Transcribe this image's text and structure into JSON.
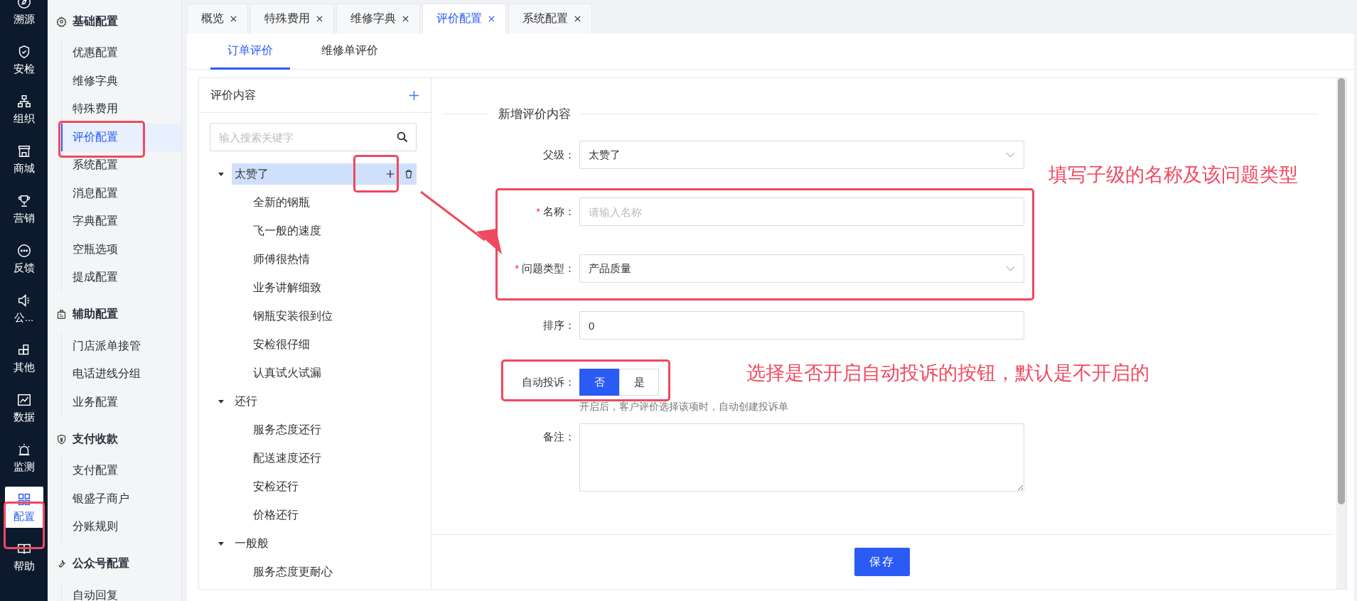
{
  "rail": [
    {
      "label": "溯源",
      "kind": "compass",
      "selected": false
    },
    {
      "label": "安检",
      "kind": "shield",
      "selected": false
    },
    {
      "label": "组织",
      "kind": "org",
      "selected": false
    },
    {
      "label": "商城",
      "kind": "store",
      "selected": false
    },
    {
      "label": "营销",
      "kind": "trophy",
      "selected": false
    },
    {
      "label": "反馈",
      "kind": "chat",
      "selected": false
    },
    {
      "label": "公...",
      "kind": "speaker",
      "selected": false
    },
    {
      "label": "其他",
      "kind": "blocks",
      "selected": false
    },
    {
      "label": "数据",
      "kind": "chart",
      "selected": false
    },
    {
      "label": "监测",
      "kind": "alarm",
      "selected": false
    },
    {
      "label": "配置",
      "kind": "grid",
      "selected": true
    },
    {
      "label": "帮助",
      "kind": "book",
      "selected": false
    }
  ],
  "menu": [
    {
      "title": "基础配置",
      "kind": "gear",
      "items": [
        {
          "label": "优惠配置",
          "selected": false
        },
        {
          "label": "维修字典",
          "selected": false
        },
        {
          "label": "特殊费用",
          "selected": false
        },
        {
          "label": "评价配置",
          "selected": true
        },
        {
          "label": "系统配置",
          "selected": false
        },
        {
          "label": "消息配置",
          "selected": false
        },
        {
          "label": "字典配置",
          "selected": false
        },
        {
          "label": "空瓶选项",
          "selected": false
        },
        {
          "label": "提成配置",
          "selected": false
        }
      ]
    },
    {
      "title": "辅助配置",
      "kind": "badge",
      "items": [
        {
          "label": "门店派单接管",
          "selected": false
        },
        {
          "label": "电话进线分组",
          "selected": false
        },
        {
          "label": "业务配置",
          "selected": false
        }
      ]
    },
    {
      "title": "支付收款",
      "kind": "yen",
      "items": [
        {
          "label": "支付配置",
          "selected": false
        },
        {
          "label": "银盛子商户",
          "selected": false
        },
        {
          "label": "分账规则",
          "selected": false
        }
      ]
    },
    {
      "title": "公众号配置",
      "kind": "wrench",
      "items": [
        {
          "label": "自动回复",
          "selected": false
        }
      ]
    }
  ],
  "tabs": [
    {
      "label": "概览",
      "selected": false
    },
    {
      "label": "特殊费用",
      "selected": false
    },
    {
      "label": "维修字典",
      "selected": false
    },
    {
      "label": "评价配置",
      "selected": true
    },
    {
      "label": "系统配置",
      "selected": false
    }
  ],
  "subtabs": [
    {
      "label": "订单评价",
      "selected": true
    },
    {
      "label": "维修单评价",
      "selected": false
    }
  ],
  "tree_panel": {
    "title": "评价内容",
    "search": {
      "placeholder": "输入搜索关键字"
    },
    "nodes": [
      {
        "label": "太赞了",
        "expanded": true,
        "selected": true,
        "children": [
          {
            "label": "全新的钢瓶",
            "selected": false
          },
          {
            "label": "飞一般的速度",
            "selected": false
          },
          {
            "label": "师傅很热情",
            "selected": false
          },
          {
            "label": "业务讲解细致",
            "selected": false
          },
          {
            "label": "钢瓶安装很到位",
            "selected": false
          },
          {
            "label": "安检很仔细",
            "selected": false
          },
          {
            "label": "认真试火试漏",
            "selected": false
          }
        ]
      },
      {
        "label": "还行",
        "expanded": true,
        "selected": false,
        "children": [
          {
            "label": "服务态度还行",
            "selected": false
          },
          {
            "label": "配送速度还行",
            "selected": false
          },
          {
            "label": "安检还行",
            "selected": false
          },
          {
            "label": "价格还行",
            "selected": false
          }
        ]
      },
      {
        "label": "一般般",
        "expanded": true,
        "selected": false,
        "children": [
          {
            "label": "服务态度更耐心",
            "selected": false
          }
        ]
      }
    ]
  },
  "form": {
    "title": "新增评价内容",
    "fields": [
      {
        "kind": "select",
        "label": "父级：",
        "value": "太赞了"
      },
      {
        "kind": "input",
        "label": "名称：",
        "mark": "*",
        "placeholder": "请输入名称"
      },
      {
        "kind": "select",
        "label": "问题类型：",
        "mark": "*",
        "value": "产品质量"
      },
      {
        "kind": "input",
        "label": "排序：",
        "value": "0"
      },
      {
        "kind": "toggle",
        "label": "自动投诉：",
        "options": [
          {
            "label": "否",
            "selected": true
          },
          {
            "label": "是",
            "selected": false
          }
        ],
        "help": "开启后，客户评价选择该项时，自动创建投诉单"
      },
      {
        "kind": "textarea",
        "label": "备注："
      }
    ]
  },
  "footer": {
    "save": "保存"
  },
  "annotations": [
    {
      "text": "填写子级的名称及该问题类型"
    },
    {
      "text": "选择是否开启自动投诉的按钮，默认是不开启的"
    }
  ]
}
